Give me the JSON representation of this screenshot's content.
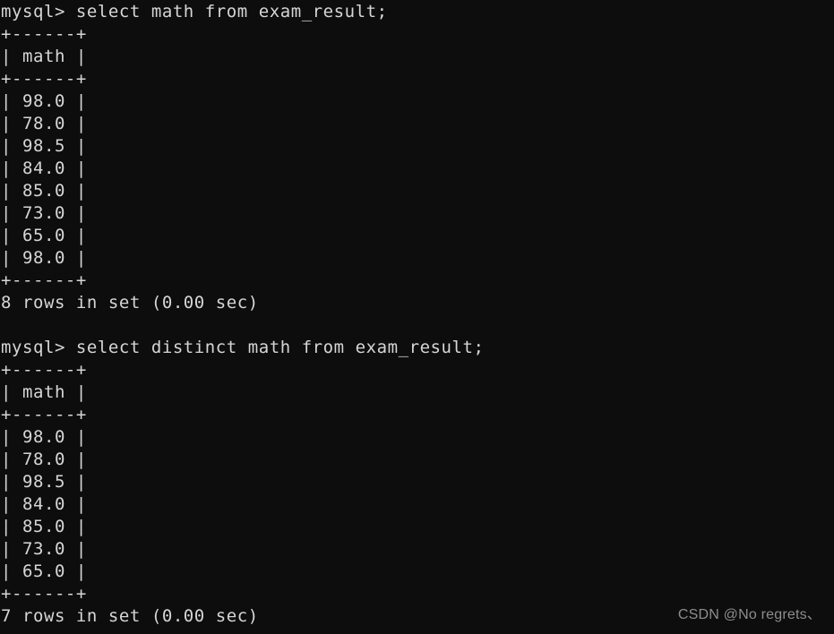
{
  "terminal": {
    "prompt": "mysql> ",
    "background_color": "#0d0d0d",
    "text_color": "#d6d6d6",
    "blocks": [
      {
        "command": "select math from exam_result;",
        "prompt_line": "mysql> select math from exam_result;",
        "table": {
          "rule": "+------+",
          "header_row": "| math |",
          "column_header": "math",
          "rows": [
            "| 98.0 |",
            "| 78.0 |",
            "| 98.5 |",
            "| 84.0 |",
            "| 85.0 |",
            "| 73.0 |",
            "| 65.0 |",
            "| 98.0 |"
          ],
          "values": [
            "98.0",
            "78.0",
            "98.5",
            "84.0",
            "85.0",
            "73.0",
            "65.0",
            "98.0"
          ]
        },
        "status": "8 rows in set (0.00 sec)",
        "row_count": 8,
        "duration": "0.00 sec"
      },
      {
        "command": "select distinct math from exam_result;",
        "prompt_line": "mysql> select distinct math from exam_result;",
        "table": {
          "rule": "+------+",
          "header_row": "| math |",
          "column_header": "math",
          "rows": [
            "| 98.0 |",
            "| 78.0 |",
            "| 98.5 |",
            "| 84.0 |",
            "| 85.0 |",
            "| 73.0 |",
            "| 65.0 |"
          ],
          "values": [
            "98.0",
            "78.0",
            "98.5",
            "84.0",
            "85.0",
            "73.0",
            "65.0"
          ]
        },
        "status": "7 rows in set (0.00 sec)",
        "row_count": 7,
        "duration": "0.00 sec"
      }
    ]
  },
  "watermark": {
    "text": "CSDN @No regrets、"
  }
}
